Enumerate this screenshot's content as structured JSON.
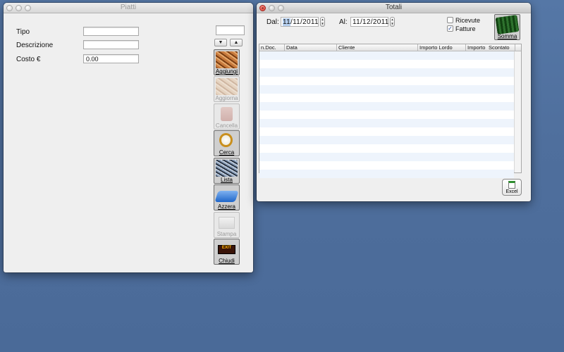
{
  "piatti_window": {
    "title": "Piatti",
    "fields": [
      {
        "label": "Tipo",
        "value": ""
      },
      {
        "label": "Descrizione",
        "value": ""
      },
      {
        "label": "Costo €",
        "value": "0.00"
      }
    ],
    "record_field": "",
    "nav": {
      "down": "▼",
      "up": "▲"
    },
    "buttons": {
      "aggiungi": "Aggiungi",
      "aggiorna": "Aggiorna",
      "cancella": "Cancella",
      "cerca": "Cerca",
      "lista": "Lista",
      "azzera": "Azzera",
      "stampa": "Stampa",
      "chiudi": "Chiudi",
      "chiudi_sign": "EXIT"
    }
  },
  "totali_window": {
    "title": "Totali",
    "dal_label": "Dal:",
    "dal_day": "11",
    "dal_rest": "/11/2011",
    "al_label": "Al:",
    "al_value": "11/12/2011",
    "checkboxes": {
      "ricevute": {
        "label": "Ricevute",
        "checked": false,
        "mark": ""
      },
      "fatture": {
        "label": "Fatture",
        "checked": true,
        "mark": "✓"
      }
    },
    "somma_label": "Somma",
    "columns": [
      "n.Doc.",
      "Data",
      "Cliente",
      "Importo Lordo",
      "Importo",
      "Scontato"
    ],
    "rows": [],
    "excel_label": "Excel"
  }
}
